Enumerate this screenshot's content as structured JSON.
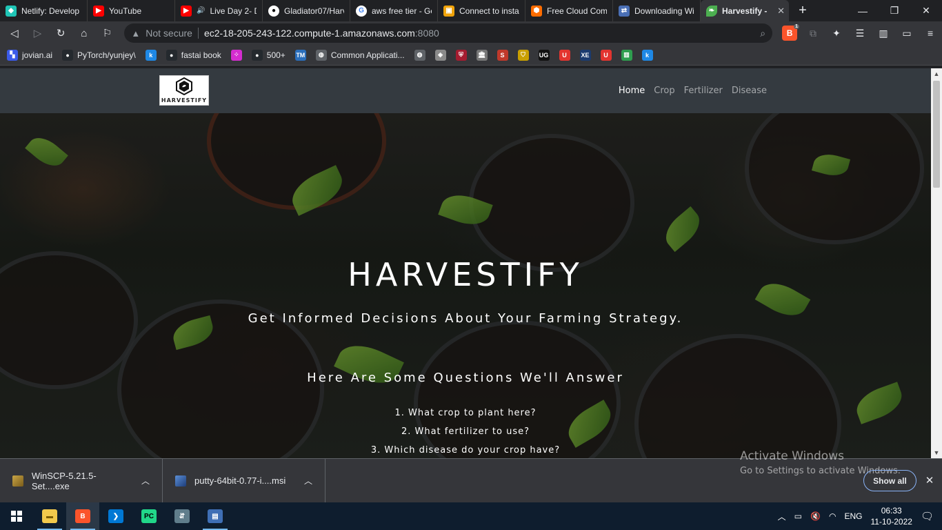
{
  "browser": {
    "tabs": [
      {
        "title": "Netlify: Develop",
        "icon": "netlify-icon",
        "color": "#20c6b7"
      },
      {
        "title": "YouTube",
        "icon": "youtube-icon",
        "color": "#ff0000"
      },
      {
        "title": "Live Day 2- D",
        "icon": "youtube-icon",
        "color": "#ff0000"
      },
      {
        "title": "Gladiator07/Harv",
        "icon": "github-icon",
        "color": "#24292e"
      },
      {
        "title": "aws free tier - Go",
        "icon": "google-icon",
        "color": "#4285f4"
      },
      {
        "title": "Connect to insta",
        "icon": "aws-box-icon",
        "color": "#f0a30a"
      },
      {
        "title": "Free Cloud Comp",
        "icon": "cloud-icon",
        "color": "#ff6d00"
      },
      {
        "title": "Downloading Wi",
        "icon": "winscp-icon",
        "color": "#4a6fb5"
      },
      {
        "title": "Harvestify - ",
        "icon": "leaf-icon",
        "color": "#4caf50"
      }
    ],
    "url_warning": "Not secure",
    "url_host": "ec2-18-205-243-122.compute-1.amazonaws.com",
    "url_port": ":8080",
    "brave_badge": "1",
    "bookmarks": [
      {
        "label": "jovian.ai",
        "icon": "jovian-icon",
        "color": "#3b5ae8"
      },
      {
        "label": "PyTorch/yunjey\\",
        "icon": "github-icon",
        "color": "#24292e"
      },
      {
        "label": "",
        "icon": "k-icon",
        "color": "#1e88e5"
      },
      {
        "label": "fastai book",
        "icon": "github-icon",
        "color": "#24292e"
      },
      {
        "label": "",
        "icon": "dots-icon",
        "color": "#d42ccf"
      },
      {
        "label": "500+",
        "icon": "github-icon",
        "color": "#24292e"
      },
      {
        "label": "",
        "icon": "tm-icon",
        "color": "#2a6ebb"
      },
      {
        "label": "Common Applicati...",
        "icon": "globe-icon",
        "color": "#5f6368"
      },
      {
        "label": "",
        "icon": "globe-icon",
        "color": "#5f6368"
      },
      {
        "label": "",
        "icon": "mit-icon",
        "color": "#8a8a8a"
      },
      {
        "label": "",
        "icon": "harvard-icon",
        "color": "#a51c30"
      },
      {
        "label": "",
        "icon": "institution-icon",
        "color": "#777"
      },
      {
        "label": "",
        "icon": "stanford-icon",
        "color": "#c0392b"
      },
      {
        "label": "",
        "icon": "shield-icon",
        "color": "#c9a000"
      },
      {
        "label": "",
        "icon": "ug-icon",
        "color": "#111"
      },
      {
        "label": "",
        "icon": "u-icon",
        "color": "#e3342f"
      },
      {
        "label": "",
        "icon": "xe-icon",
        "color": "#1b3b6f"
      },
      {
        "label": "",
        "icon": "u-icon",
        "color": "#e3342f"
      },
      {
        "label": "",
        "icon": "chart-icon",
        "color": "#2e9e4f"
      },
      {
        "label": "",
        "icon": "k-icon",
        "color": "#1e88e5"
      }
    ]
  },
  "site": {
    "logo_text": "HARVESTIFY",
    "nav": [
      "Home",
      "Crop",
      "Fertilizer",
      "Disease"
    ],
    "hero_title": "HARVESTIFY",
    "hero_subtitle": "Get Informed Decisions About Your Farming Strategy.",
    "questions_heading": "Here Are Some Questions We'll Answer",
    "questions": [
      "1. What crop to plant here?",
      "2. What fertilizer to use?",
      "3. Which disease do your crop have?"
    ]
  },
  "downloads": {
    "items": [
      {
        "name": "WinSCP-5.21.5-Set....exe"
      },
      {
        "name": "putty-64bit-0.77-i....msi"
      }
    ],
    "show_all": "Show all"
  },
  "activation": {
    "line1": "Activate Windows",
    "line2": "Go to Settings to activate Windows."
  },
  "taskbar": {
    "language": "ENG",
    "time": "06:33",
    "date": "11-10-2022"
  }
}
